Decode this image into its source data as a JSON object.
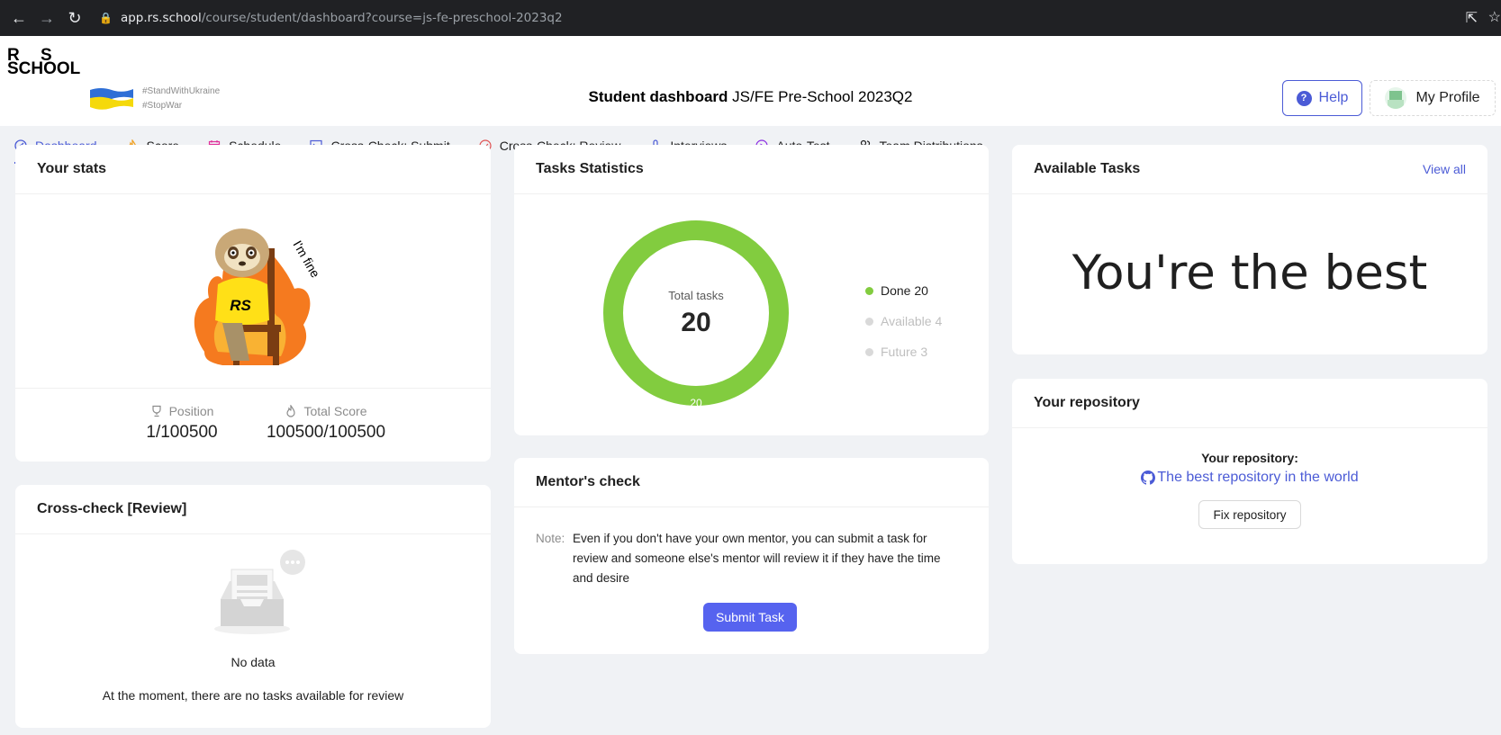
{
  "browser": {
    "url_host": "app.rs.school",
    "url_path": "/course/student/dashboard?course=js-fe-preschool-2023q2"
  },
  "header": {
    "logo_line1": "R S",
    "logo_line2": "SCHOOL",
    "tag1": "#StandWithUkraine",
    "tag2": "#StopWar",
    "title_bold": "Student dashboard",
    "title_course": "JS/FE Pre-School 2023Q2",
    "help_label": "Help",
    "profile_label": "My Profile"
  },
  "tabs": [
    {
      "label": "Dashboard",
      "icon": "dashboard-icon",
      "color": "#4b5bd6"
    },
    {
      "label": "Score",
      "icon": "fire-icon",
      "color": "#f0a020"
    },
    {
      "label": "Schedule",
      "icon": "calendar-icon",
      "color": "#e0309a"
    },
    {
      "label": "Cross-Check: Submit",
      "icon": "code-icon",
      "color": "#4b5bd6"
    },
    {
      "label": "Cross-Check: Review",
      "icon": "check-circle-icon",
      "color": "#e05050"
    },
    {
      "label": "Interviews",
      "icon": "microphone-icon",
      "color": "#4b5bd6"
    },
    {
      "label": "Auto-Test",
      "icon": "play-circle-icon",
      "color": "#8a2be2"
    },
    {
      "label": "Team Distributions",
      "icon": "team-icon",
      "color": "#1f1f1f"
    }
  ],
  "stats": {
    "title": "Your stats",
    "sticker_text": "I'm fine",
    "sticker_shirt": "RS",
    "position_label": "Position",
    "position_value": "1/100500",
    "score_label": "Total Score",
    "score_value": "100500/100500"
  },
  "cross_check": {
    "title": "Cross-check [Review]",
    "empty_title": "No data",
    "empty_message": "At the moment, there are no tasks available for review"
  },
  "tasks": {
    "title": "Tasks Statistics",
    "center_label": "Total tasks",
    "center_value": "20",
    "ring_label": "20",
    "legend": [
      {
        "label": "Done 20",
        "color": "#82cc3f",
        "text_color": "#1f1f1f"
      },
      {
        "label": "Available 4",
        "color": "#d9d9d9",
        "text_color": "#bfbfbf"
      },
      {
        "label": "Future 3",
        "color": "#d9d9d9",
        "text_color": "#bfbfbf"
      }
    ]
  },
  "chart_data": {
    "type": "pie",
    "categories": [
      "Done",
      "Available",
      "Future"
    ],
    "values": [
      20,
      4,
      3
    ],
    "title": "Total tasks"
  },
  "mentor": {
    "title": "Mentor's check",
    "note_label": "Note:",
    "note_text": "Even if you don't have your own mentor, you can submit a task for review and someone else's mentor will review it if they have the time and desire",
    "submit_label": "Submit Task"
  },
  "available": {
    "title": "Available Tasks",
    "view_all": "View all",
    "message": "You're the best"
  },
  "repository": {
    "title": "Your repository",
    "label": "Your repository:",
    "link_text": "The best repository in the world",
    "fix_label": "Fix repository"
  },
  "colors": {
    "accent": "#4b5bd6",
    "submit": "#5663ef",
    "done": "#82cc3f",
    "background": "#f0f2f5"
  }
}
